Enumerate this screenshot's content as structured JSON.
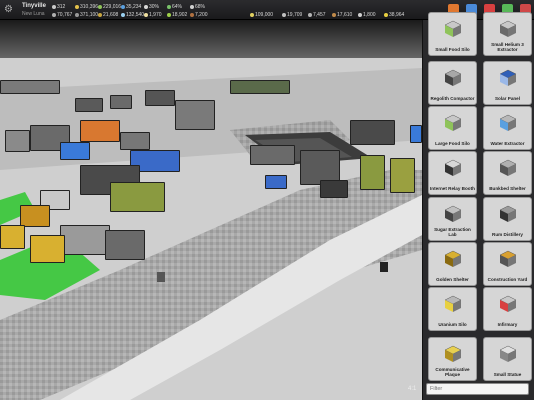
{
  "colony": {
    "name": "Tinyville",
    "subtitle": "New Luna"
  },
  "stats_row1": [
    {
      "icon": "person-icon",
      "value": "312",
      "color": "#c9c9c9"
    },
    {
      "icon": "coin-icon",
      "value": "310,396",
      "color": "#e3c14b"
    },
    {
      "icon": "food-icon",
      "value": "229,016",
      "color": "#8fc35a"
    },
    {
      "icon": "water-icon",
      "value": "35,234",
      "color": "#5aa0e0"
    },
    {
      "icon": "oxygen-icon",
      "value": "30%",
      "color": "#d8d8d8"
    },
    {
      "icon": "morale-icon",
      "value": "64%",
      "color": "#79c26a"
    },
    {
      "icon": "health-icon",
      "value": "68%",
      "color": "#d0d0d0"
    }
  ],
  "stats_row2": [
    {
      "icon": "regolith-icon",
      "value": "70,767",
      "color": "#b0b0b0"
    },
    {
      "icon": "metal-icon",
      "value": "371,100",
      "color": "#9a9a9a"
    },
    {
      "icon": "helium-icon",
      "value": "21,608",
      "color": "#c8a640"
    },
    {
      "icon": "ice-icon",
      "value": "132,540",
      "color": "#9ad0f0"
    },
    {
      "icon": "sugar-icon",
      "value": "1,970",
      "color": "#f0e0a0"
    },
    {
      "icon": "uranium-icon",
      "value": "18,902",
      "color": "#9fd24a"
    },
    {
      "icon": "rum-icon",
      "value": "7,200",
      "color": "#b07040"
    }
  ],
  "stats_right": [
    {
      "icon": "energy-icon",
      "value": "109,000",
      "color": "#e0d060"
    },
    {
      "icon": "research-icon",
      "value": "19,709",
      "color": "#c0c0c0"
    },
    {
      "icon": "tool-icon",
      "value": "7,457",
      "color": "#b5b5b5"
    },
    {
      "icon": "crate-icon",
      "value": "17,610",
      "color": "#c08a4a"
    },
    {
      "icon": "dna-icon",
      "value": "1,800",
      "color": "#d0d0d0"
    },
    {
      "icon": "star-icon",
      "value": "38,964",
      "color": "#e8d040"
    }
  ],
  "toolbar_icons": [
    {
      "name": "chat-icon",
      "color": "#e07830"
    },
    {
      "name": "trade-icon",
      "color": "#4a8ad8"
    },
    {
      "name": "bookmark-icon",
      "color": "#d84040"
    },
    {
      "name": "crosshair-icon",
      "color": "#58b858"
    },
    {
      "name": "gift-icon",
      "color": "#d04848"
    }
  ],
  "buildings": [
    {
      "label": "Small Food Silo",
      "color": "#c8c8c8",
      "accent": "#8fc35a"
    },
    {
      "label": "Small Helium 3 Extractor",
      "color": "#c8c8c8",
      "accent": "#6a6a6a"
    },
    {
      "label": "Regolith Compactor",
      "color": "#a8a8a8",
      "accent": "#444"
    },
    {
      "label": "Solar Panel",
      "color": "#2f5fb8",
      "accent": "#9ab8e8"
    },
    {
      "label": "Large Food Silo",
      "color": "#c8c8c8",
      "accent": "#8fc35a"
    },
    {
      "label": "Water Extractor",
      "color": "#b8b8b8",
      "accent": "#5aa0e0"
    },
    {
      "label": "Internet Relay Booth",
      "color": "#d8d8d8",
      "accent": "#333"
    },
    {
      "label": "Bunkbed Shelter",
      "color": "#b0b0b0",
      "accent": "#555"
    },
    {
      "label": "Sugar Extraction Lab",
      "color": "#c0c0c0",
      "accent": "#444"
    },
    {
      "label": "Rum Distillery",
      "color": "#9a9a9a",
      "accent": "#333"
    },
    {
      "label": "Golden Shelter",
      "color": "#d8b030",
      "accent": "#8a6a10"
    },
    {
      "label": "Construction Yard",
      "color": "#d8a030",
      "accent": "#555"
    },
    {
      "label": "Uranium Silo",
      "color": "#b8b8b8",
      "accent": "#e8d040"
    },
    {
      "label": "Infirmary",
      "color": "#c8c8c8",
      "accent": "#d84040"
    },
    {
      "label": "Communicative Plaque",
      "color": "#e8d050",
      "accent": "#b09020"
    },
    {
      "label": "Small Statue",
      "color": "#e0e0e0",
      "accent": "#888"
    }
  ],
  "filter": {
    "placeholder": "Filter"
  },
  "speed": "4:1"
}
